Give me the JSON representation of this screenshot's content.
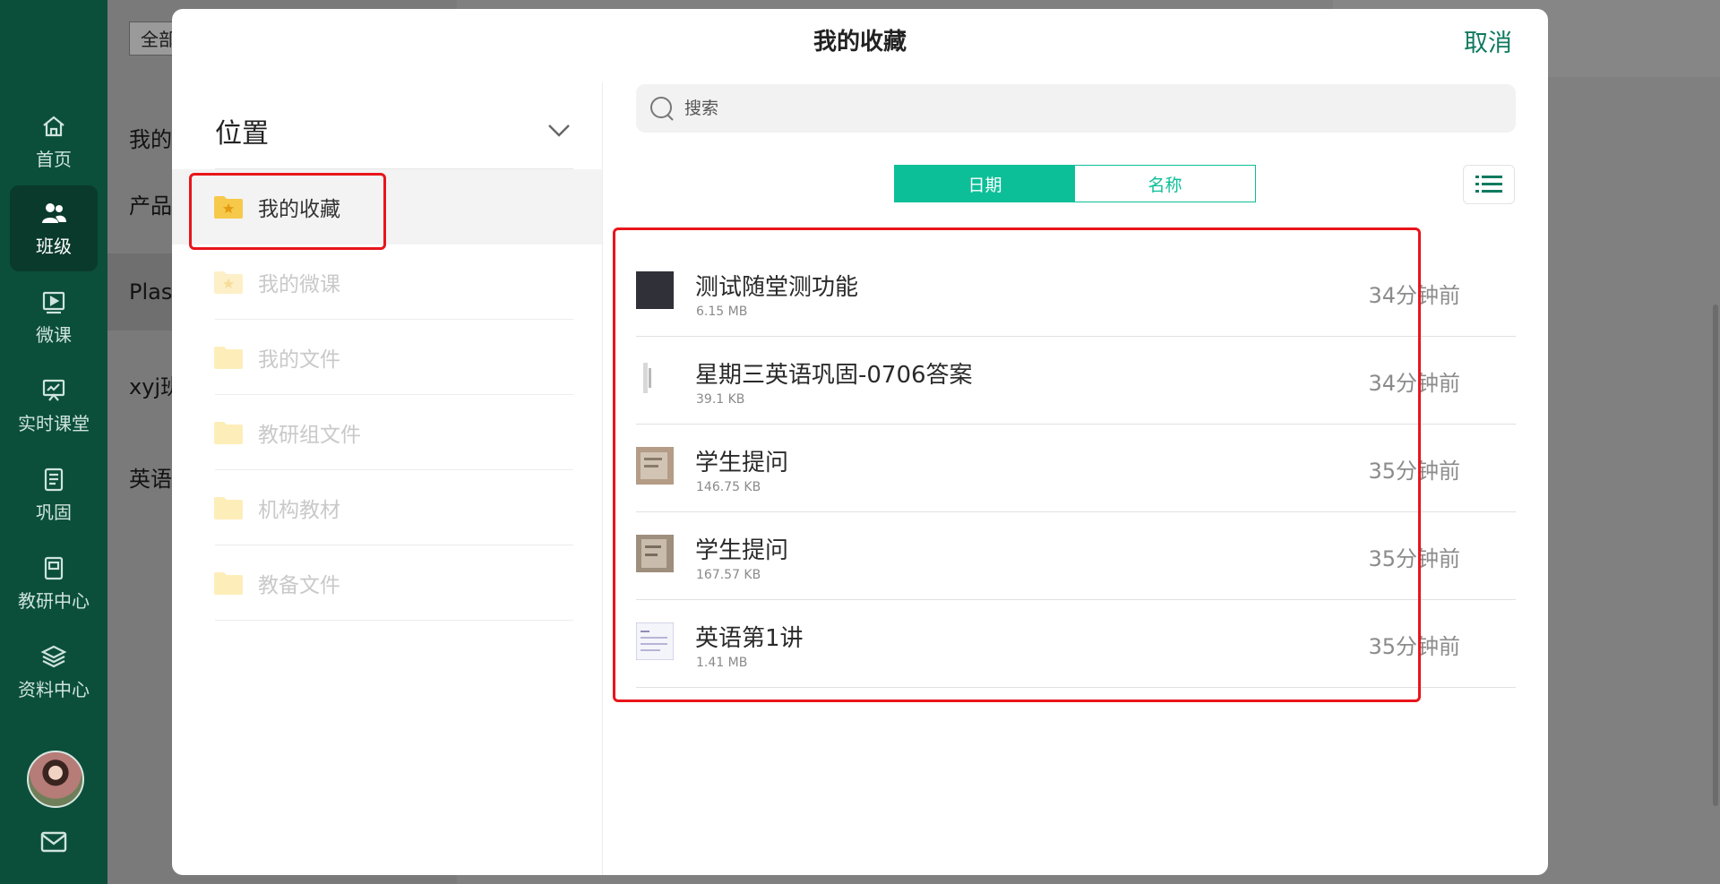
{
  "nav": {
    "items": [
      {
        "label": "首页",
        "icon": "home-icon"
      },
      {
        "label": "班级",
        "icon": "class-icon",
        "active": true
      },
      {
        "label": "微课",
        "icon": "microlesson-icon"
      },
      {
        "label": "实时课堂",
        "icon": "live-class-icon"
      },
      {
        "label": "巩固",
        "icon": "practice-icon"
      },
      {
        "label": "教研中心",
        "icon": "research-icon"
      },
      {
        "label": "资料中心",
        "icon": "layers-icon"
      }
    ],
    "colors": {
      "background": "#0b4f3b",
      "active": "#0a3a2b"
    }
  },
  "background": {
    "filter_label": "全部",
    "rows": [
      "我的",
      "产品",
      "Plase",
      "xyj班",
      "英语"
    ]
  },
  "modal": {
    "title": "我的收藏",
    "cancel_label": "取消",
    "location": {
      "title": "位置",
      "folders": [
        {
          "label": "我的收藏",
          "icon": "starred-folder-icon",
          "active": true
        },
        {
          "label": "我的微课",
          "icon": "starred-folder-icon"
        },
        {
          "label": "我的文件",
          "icon": "folder-icon"
        },
        {
          "label": "教研组文件",
          "icon": "folder-icon"
        },
        {
          "label": "机构教材",
          "icon": "folder-icon"
        },
        {
          "label": "教备文件",
          "icon": "folder-icon"
        }
      ]
    },
    "search": {
      "placeholder": "搜索"
    },
    "sort_tabs": [
      {
        "label": "日期",
        "active": true
      },
      {
        "label": "名称",
        "active": false
      }
    ],
    "files": [
      {
        "name": "测试随堂测功能",
        "size": "6.15 MB",
        "time": "34分钟前"
      },
      {
        "name": "星期三英语巩固-0706答案",
        "size": "39.1 KB",
        "time": "34分钟前"
      },
      {
        "name": "学生提问",
        "size": "146.75 KB",
        "time": "35分钟前"
      },
      {
        "name": "学生提问",
        "size": "167.57 KB",
        "time": "35分钟前"
      },
      {
        "name": "英语第1讲",
        "size": "1.41 MB",
        "time": "35分钟前"
      }
    ],
    "colors": {
      "accent": "#0dbf98",
      "cancel": "#0e7a5f",
      "highlight_box": "#e8151b"
    }
  }
}
